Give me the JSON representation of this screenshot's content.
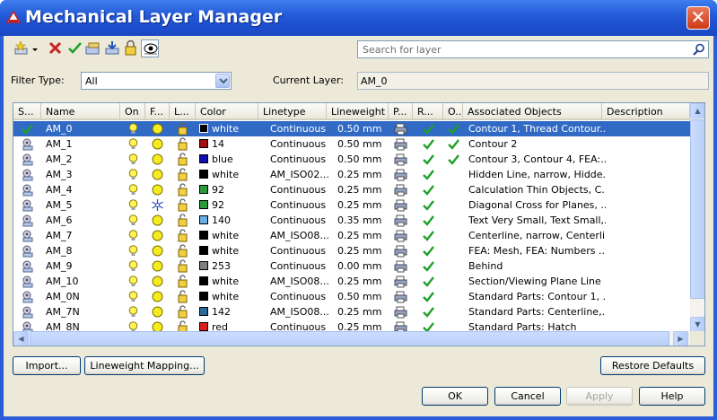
{
  "window": {
    "title": "Mechanical Layer Manager",
    "close_label": "✕"
  },
  "toolbar": {
    "icons": [
      "new-layer-icon",
      "dropdown-arrow-icon",
      "delete-icon",
      "set-current-icon",
      "layer-states-icon",
      "import-icon",
      "lock-icon",
      "preview-icon"
    ]
  },
  "search": {
    "placeholder": "Search for layer"
  },
  "filter": {
    "label": "Filter Type:",
    "value": "All"
  },
  "current_layer": {
    "label": "Current Layer:",
    "value": "AM_0"
  },
  "columns": [
    "S...",
    "Name",
    "On",
    "F...",
    "L...",
    "Color",
    "Linetype",
    "Lineweight",
    "P...",
    "R...",
    "O...",
    "Associated Objects",
    "Description"
  ],
  "rows": [
    {
      "name": "AM_0",
      "color_hex": "#000000",
      "color": "white",
      "linetype": "Continuous",
      "lineweight": "0.50 mm",
      "r": true,
      "o": true,
      "assoc": "Contour 1, Thread Contour...",
      "freeze": "sun",
      "current": true
    },
    {
      "name": "AM_1",
      "color_hex": "#a01010",
      "color": "14",
      "linetype": "Continuous",
      "lineweight": "0.50 mm",
      "r": true,
      "o": true,
      "assoc": "Contour 2",
      "freeze": "sun"
    },
    {
      "name": "AM_2",
      "color_hex": "#1010b0",
      "color": "blue",
      "linetype": "Continuous",
      "lineweight": "0.50 mm",
      "r": true,
      "o": true,
      "assoc": "Contour 3, Contour 4, FEA:...",
      "freeze": "sun"
    },
    {
      "name": "AM_3",
      "color_hex": "#000000",
      "color": "white",
      "linetype": "AM_ISO02...",
      "lineweight": "0.25 mm",
      "r": true,
      "o": false,
      "assoc": "Hidden Line, narrow, Hidde...",
      "freeze": "sun"
    },
    {
      "name": "AM_4",
      "color_hex": "#2a9a3a",
      "color": "92",
      "linetype": "Continuous",
      "lineweight": "0.25 mm",
      "r": true,
      "o": false,
      "assoc": "Calculation Thin Objects, C...",
      "freeze": "sun"
    },
    {
      "name": "AM_5",
      "color_hex": "#2a9a3a",
      "color": "92",
      "linetype": "Continuous",
      "lineweight": "0.25 mm",
      "r": true,
      "o": false,
      "assoc": "Diagonal Cross for Planes, ...",
      "freeze": "snow"
    },
    {
      "name": "AM_6",
      "color_hex": "#6ab0e8",
      "color": "140",
      "linetype": "Continuous",
      "lineweight": "0.35 mm",
      "r": true,
      "o": false,
      "assoc": "Text Very Small, Text Small,...",
      "freeze": "sun"
    },
    {
      "name": "AM_7",
      "color_hex": "#000000",
      "color": "white",
      "linetype": "AM_ISO08...",
      "lineweight": "0.25 mm",
      "r": true,
      "o": false,
      "assoc": "Centerline, narrow, Centerli...",
      "freeze": "sun"
    },
    {
      "name": "AM_8",
      "color_hex": "#000000",
      "color": "white",
      "linetype": "Continuous",
      "lineweight": "0.25 mm",
      "r": true,
      "o": false,
      "assoc": "FEA: Mesh, FEA: Numbers ...",
      "freeze": "sun"
    },
    {
      "name": "AM_9",
      "color_hex": "#7f7f7f",
      "color": "253",
      "linetype": "Continuous",
      "lineweight": "0.00 mm",
      "r": true,
      "o": false,
      "assoc": "Behind",
      "freeze": "sun"
    },
    {
      "name": "AM_10",
      "color_hex": "#000000",
      "color": "white",
      "linetype": "AM_ISO08...",
      "lineweight": "0.25 mm",
      "r": true,
      "o": false,
      "assoc": "Section/Viewing Plane Line",
      "freeze": "sun"
    },
    {
      "name": "AM_0N",
      "color_hex": "#000000",
      "color": "white",
      "linetype": "Continuous",
      "lineweight": "0.50 mm",
      "r": true,
      "o": false,
      "assoc": "Standard Parts: Contour 1, ...",
      "freeze": "sun"
    },
    {
      "name": "AM_7N",
      "color_hex": "#2a6a9a",
      "color": "142",
      "linetype": "AM_ISO08...",
      "lineweight": "0.25 mm",
      "r": true,
      "o": false,
      "assoc": "Standard Parts: Centerline,...",
      "freeze": "sun"
    },
    {
      "name": "AM_8N",
      "color_hex": "#d82020",
      "color": "red",
      "linetype": "Continuous",
      "lineweight": "0.25 mm",
      "r": true,
      "o": false,
      "assoc": "Standard Parts: Hatch",
      "freeze": "sun"
    }
  ],
  "buttons": {
    "import": "Import...",
    "lineweight_mapping": "Lineweight Mapping...",
    "restore_defaults": "Restore Defaults",
    "ok": "OK",
    "cancel": "Cancel",
    "apply": "Apply",
    "help": "Help"
  },
  "scrollbar_glyphs": {
    "up": "▲",
    "down": "▼",
    "left": "◀",
    "right": "▶"
  }
}
